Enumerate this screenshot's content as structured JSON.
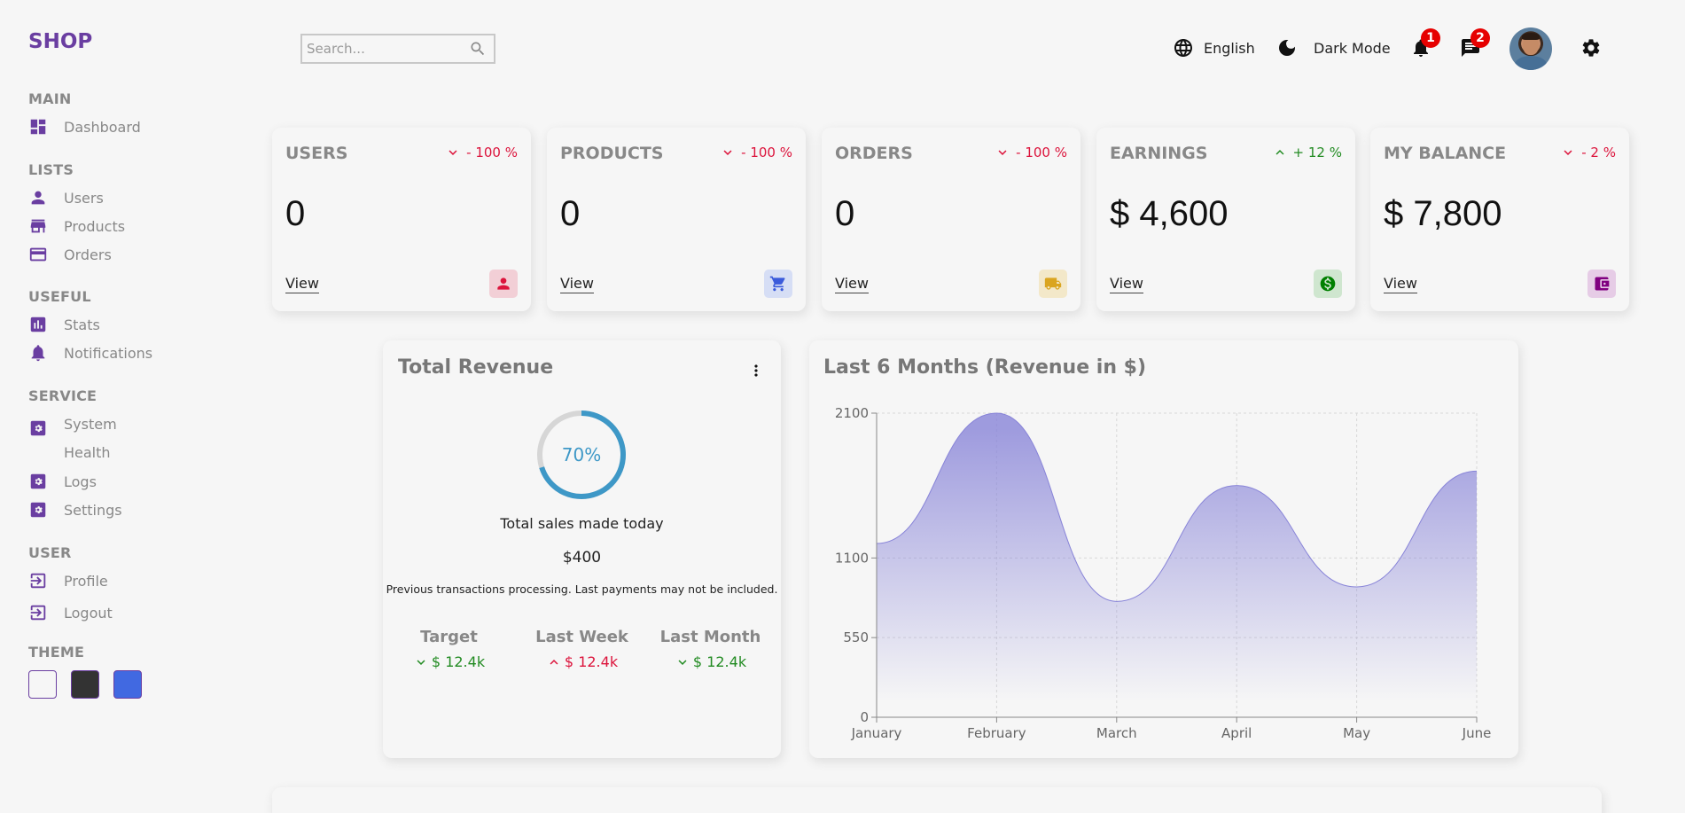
{
  "sidebar": {
    "logo": "SHOP",
    "sections": {
      "main": "MAIN",
      "lists": "LISTS",
      "useful": "USEFUL",
      "service": "SERVICE",
      "user": "USER",
      "theme": "THEME"
    },
    "items": {
      "dashboard": "Dashboard",
      "users": "Users",
      "products": "Products",
      "orders": "Orders",
      "stats": "Stats",
      "notifications": "Notifications",
      "system_health": "System Health",
      "logs": "Logs",
      "settings": "Settings",
      "profile": "Profile",
      "logout": "Logout"
    },
    "theme_colors": [
      "#f6f6f6",
      "#333333",
      "#4169e1"
    ]
  },
  "topbar": {
    "search_placeholder": "Search...",
    "language": "English",
    "dark_mode": "Dark Mode",
    "notifications_count": "1",
    "messages_count": "2"
  },
  "widgets": [
    {
      "title": "USERS",
      "percent": "- 100 %",
      "trend": "down",
      "counter": "0",
      "link": "View",
      "icon": "person-icon",
      "icon_color": "#dc143c",
      "icon_bg": "#f2cfd6"
    },
    {
      "title": "PRODUCTS",
      "percent": "- 100 %",
      "trend": "down",
      "counter": "0",
      "link": "View",
      "icon": "cart-icon",
      "icon_color": "#3b5bdb",
      "icon_bg": "#d6def5"
    },
    {
      "title": "ORDERS",
      "percent": "- 100 %",
      "trend": "down",
      "counter": "0",
      "link": "View",
      "icon": "truck-icon",
      "icon_color": "#daa520",
      "icon_bg": "#f3e8c9"
    },
    {
      "title": "EARNINGS",
      "percent": "+ 12 %",
      "trend": "up",
      "counter": "$ 4,600",
      "link": "View",
      "icon": "dollar-icon",
      "icon_color": "#008000",
      "icon_bg": "#cfe6cf"
    },
    {
      "title": "MY BALANCE",
      "percent": "- 2 %",
      "trend": "down",
      "counter": "$ 7,800",
      "link": "View",
      "icon": "wallet-icon",
      "icon_color": "#800080",
      "icon_bg": "#e6cce6"
    }
  ],
  "featured": {
    "title": "Total Revenue",
    "progress_label": "70%",
    "progress_value": 0.7,
    "sales_label": "Total sales made today",
    "amount": "$400",
    "description": "Previous transactions processing. Last payments may not be included.",
    "summary": [
      {
        "title": "Target",
        "value": "$ 12.4k",
        "trend": "down"
      },
      {
        "title": "Last Week",
        "value": "$ 12.4k",
        "trend": "up"
      },
      {
        "title": "Last Month",
        "value": "$ 12.4k",
        "trend": "down"
      }
    ],
    "colors": {
      "ring": "#3e98c7",
      "track": "#d6d6d6",
      "positive": "#228b22",
      "negative": "#dc143c"
    }
  },
  "chart_data": {
    "type": "area",
    "title": "Last 6 Months (Revenue in $)",
    "categories": [
      "January",
      "February",
      "March",
      "April",
      "May",
      "June"
    ],
    "values": [
      1200,
      2100,
      800,
      1600,
      900,
      1700
    ],
    "yticks": [
      0,
      550,
      1100,
      2100
    ],
    "ylim": [
      0,
      2100
    ],
    "grid": true,
    "color": "#8884d8"
  }
}
